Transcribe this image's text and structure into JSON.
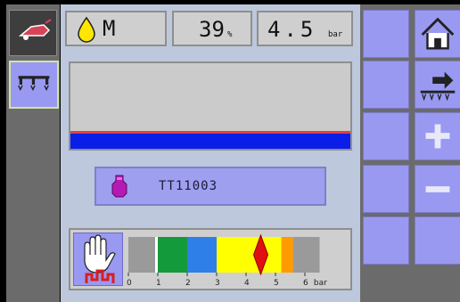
{
  "status": {
    "mode_letter": "M",
    "flow_percent": "39",
    "flow_unit": "%",
    "pressure": "4.5",
    "pressure_unit": "bar"
  },
  "nozzle": {
    "label": "TT11003"
  },
  "gauge": {
    "unit_label": "bar",
    "ticks": [
      "0",
      "1",
      "2",
      "3",
      "4",
      "5",
      "6"
    ],
    "current_pressure": 4.5,
    "zones": [
      {
        "from": 0,
        "to": 1,
        "color": "#9a9a9a"
      },
      {
        "from": 1,
        "to": 2,
        "color": "#139a3a"
      },
      {
        "from": 2,
        "to": 3,
        "color": "#2f7fe8"
      },
      {
        "from": 3,
        "to": 5.2,
        "color": "#ffff00"
      },
      {
        "from": 5.2,
        "to": 5.6,
        "color": "#ff9b00"
      },
      {
        "from": 5.6,
        "to": 6.5,
        "color": "#9a9a9a"
      }
    ]
  },
  "colors": {
    "accent": "#9999f2",
    "bar_blue": "#0a1ee8",
    "marker_red": "#e01010"
  },
  "icons": {
    "left_top": "sprayer-tractor-icon",
    "left_second": "boom-sections-icon",
    "nozzle": "nozzle-purple-icon",
    "droplet": "droplet-icon",
    "glove": "safety-glove-icon",
    "home": "home-icon",
    "boom_arrow": "boom-arrow-icon",
    "plus": "plus-icon",
    "minus": "minus-icon"
  }
}
